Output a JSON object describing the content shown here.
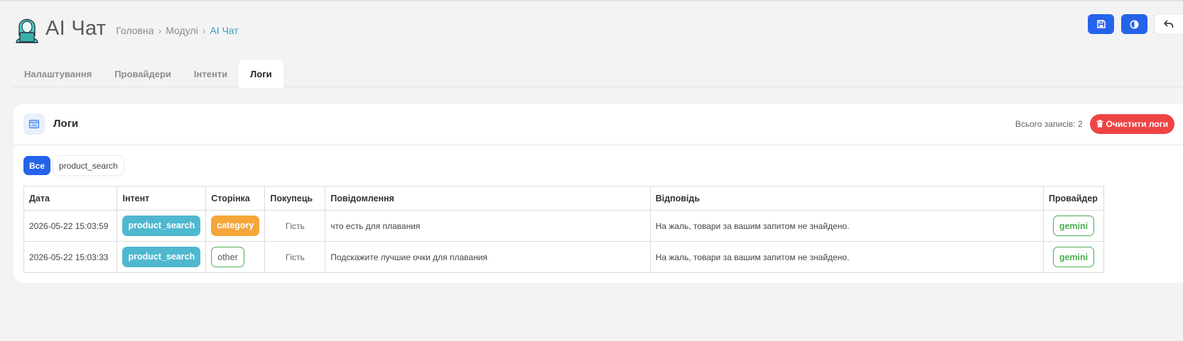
{
  "app": {
    "title": "AI Чат"
  },
  "breadcrumb": {
    "home": "Головна",
    "modules": "Модулі",
    "current": "AI Чат"
  },
  "actions": {
    "save_icon": "floppy-icon",
    "theme_icon": "contrast-icon",
    "back_icon": "reply-arrow-icon"
  },
  "tabs": [
    {
      "label": "Налаштування",
      "active": false
    },
    {
      "label": "Провайдери",
      "active": false
    },
    {
      "label": "Інтенти",
      "active": false
    },
    {
      "label": "Логи",
      "active": true
    }
  ],
  "card": {
    "title": "Логи",
    "total_label": "Всього записів: 2",
    "clear_label": "Очистити логи"
  },
  "filters": {
    "all": "Все",
    "product_search": "product_search"
  },
  "table": {
    "headers": [
      "Дата",
      "Інтент",
      "Сторінка",
      "Покупець",
      "Повідомлення",
      "Відповідь",
      "Провайдер"
    ],
    "rows": [
      {
        "date": "2026-05-22 15:03:59",
        "intent": "product_search",
        "page": "category",
        "buyer": "Гість",
        "message": "что есть для плавания",
        "answer": "На жаль, товари за вашим запитом не знайдено.",
        "provider": "gemini"
      },
      {
        "date": "2026-05-22 15:03:33",
        "intent": "product_search",
        "page": "other",
        "buyer": "Гість",
        "message": "Подскажите лучшие очки для плавания",
        "answer": "На жаль, товари за вашим запитом не знайдено.",
        "provider": "gemini"
      }
    ]
  },
  "colors": {
    "primary": "#2563eb",
    "danger": "#ef4444",
    "intent_badge": "#4fb8d0",
    "category_badge": "#f5a63a",
    "provider_badge": "#4caf50",
    "breadcrumb_active": "#3a9fc1"
  }
}
